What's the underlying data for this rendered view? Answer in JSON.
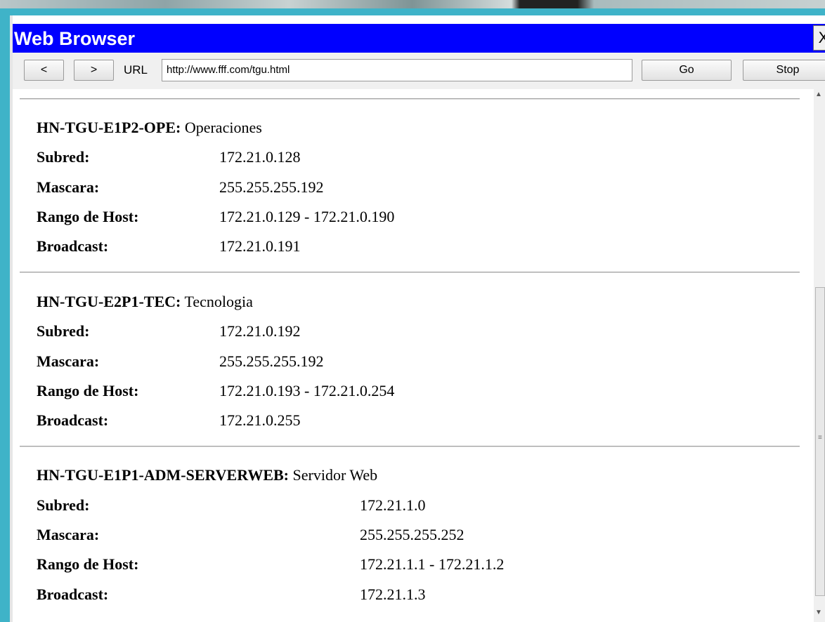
{
  "window": {
    "title": "Web Browser",
    "close_label": "X"
  },
  "toolbar": {
    "back_label": "<",
    "forward_label": ">",
    "url_label": "URL",
    "url_value": "http://www.fff.com/tgu.html",
    "go_label": "Go",
    "stop_label": "Stop"
  },
  "page": {
    "sections": [
      {
        "name": "HN-TGU-E1P2-OPE:",
        "description": "Operaciones",
        "subred_label": "Subred:",
        "subred": "172.21.0.128",
        "mascara_label": "Mascara:",
        "mascara": "255.255.255.192",
        "rango_label": "Rango de Host:",
        "rango": "172.21.0.129 - 172.21.0.190",
        "broadcast_label": "Broadcast:",
        "broadcast": "172.21.0.191"
      },
      {
        "name": "HN-TGU-E2P1-TEC:",
        "description": "Tecnologia",
        "subred_label": "Subred:",
        "subred": "172.21.0.192",
        "mascara_label": "Mascara:",
        "mascara": "255.255.255.192",
        "rango_label": "Rango de Host:",
        "rango": "172.21.0.193 - 172.21.0.254",
        "broadcast_label": "Broadcast:",
        "broadcast": "172.21.0.255"
      },
      {
        "name": "HN-TGU-E1P1-ADM-SERVERWEB:",
        "description": "Servidor Web",
        "subred_label": "Subred:",
        "subred": "172.21.1.0",
        "mascara_label": "Mascara:",
        "mascara": "255.255.255.252",
        "rango_label": "Rango de Host:",
        "rango": "172.21.1.1 - 172.21.1.2",
        "broadcast_label": "Broadcast:",
        "broadcast": "172.21.1.3"
      }
    ]
  },
  "icons": {
    "scroll_up": "scroll-up-arrow-icon",
    "scroll_down": "scroll-down-arrow-icon",
    "scroll_grip": "scroll-grip-icon"
  },
  "colors": {
    "titlebar": "#0000ff",
    "frame": "#3fb3c8"
  }
}
